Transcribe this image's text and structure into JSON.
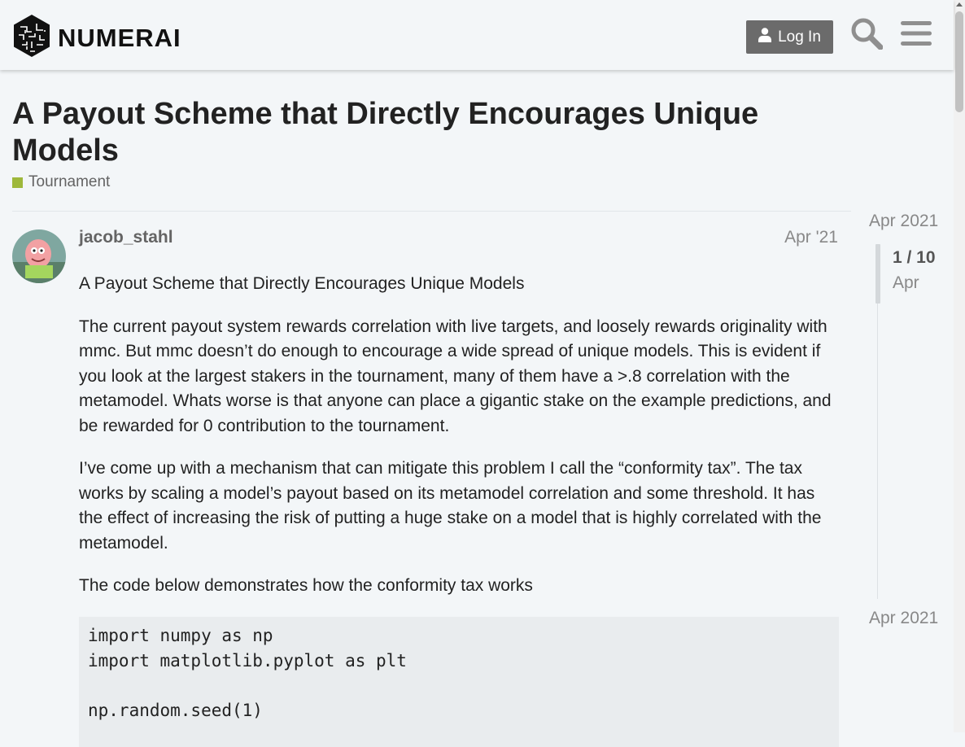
{
  "header": {
    "brand": "NUMERAI",
    "login_label": "Log In",
    "icons": [
      "numerai-logo-icon",
      "user-icon",
      "search-icon",
      "hamburger-menu-icon"
    ]
  },
  "topic": {
    "title": "A Payout Scheme that Directly Encourages Unique Models",
    "category": "Tournament",
    "category_color": "#9eb83b"
  },
  "post": {
    "username": "jacob_stahl",
    "date": "Apr '21",
    "paragraphs": [
      "A Payout Scheme that Directly Encourages Unique Models",
      "The current payout system rewards correlation with live targets, and loosely rewards originality with mmc. But mmc doesn’t do enough to encourage a wide spread of unique models. This is evident if you look at the largest stakers in the tournament, many of them have a >.8 correlation with the metamodel. Whats worse is that anyone can place a gigantic stake on the example predictions, and be rewarded for 0 contribution to the tournament.",
      "I’ve come up with a mechanism that can mitigate this problem I call the “conformity tax”. The tax works by scaling a model’s payout based on its metamodel correlation and some threshold. It has the effect of increasing the risk of putting a huge stake on a model that is highly correlated with the metamodel.",
      "The code below demonstrates how the conformity tax works"
    ],
    "code_lines": [
      "import numpy as np",
      "import matplotlib.pyplot as plt",
      "",
      "np.random.seed(1)"
    ]
  },
  "timeline": {
    "top_date": "Apr 2021",
    "position": "1 / 10",
    "current_label": "Apr",
    "bottom_date": "Apr 2021"
  }
}
